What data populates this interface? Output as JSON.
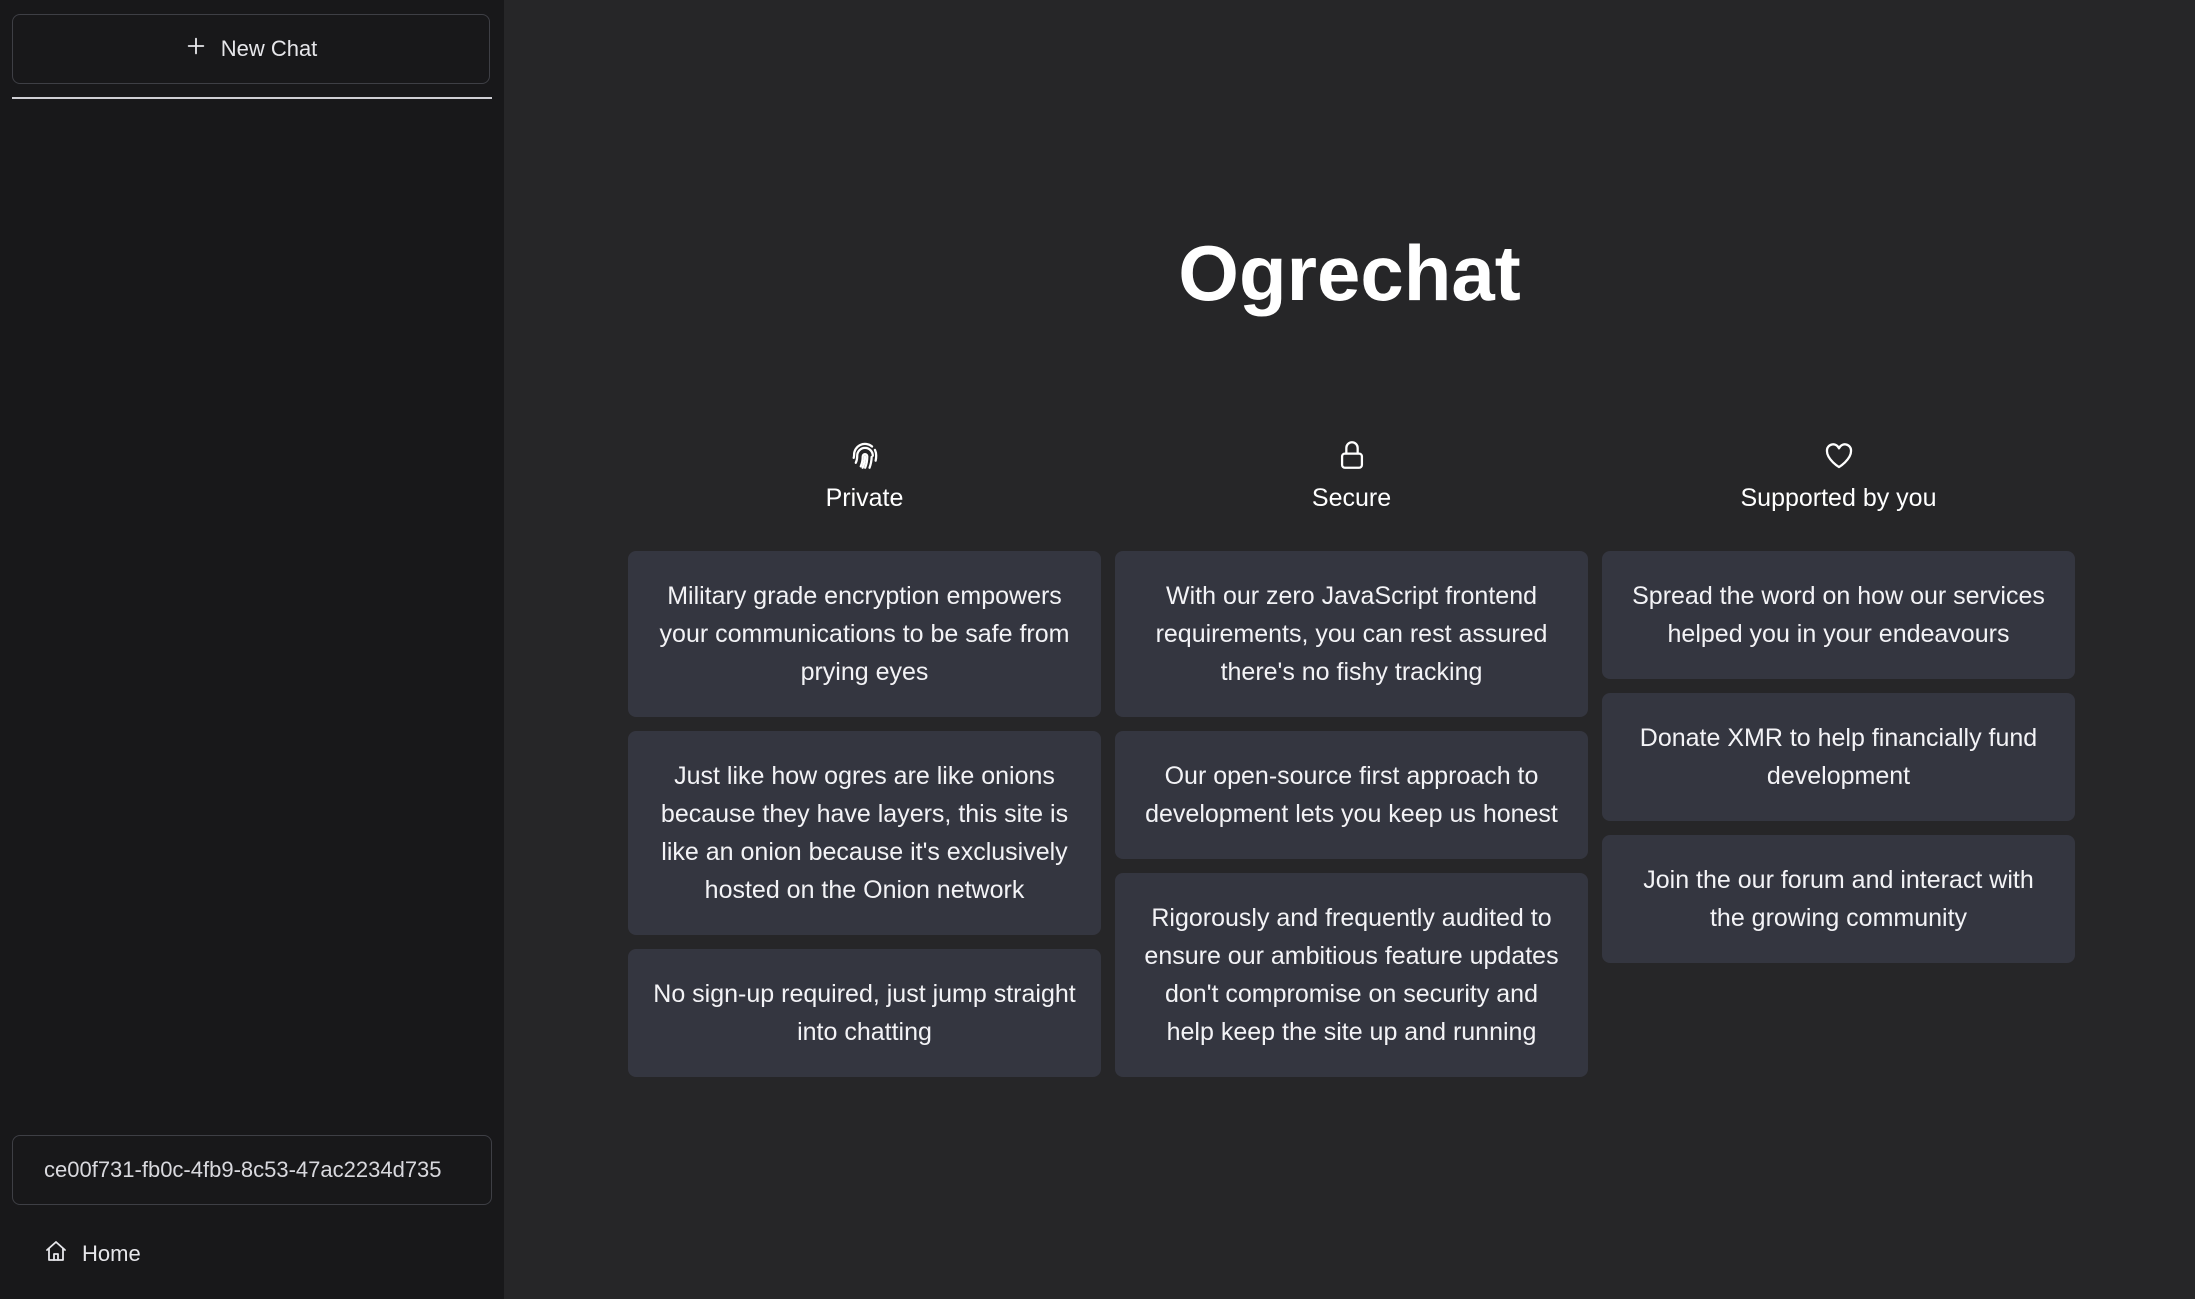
{
  "sidebar": {
    "new_chat_label": "New Chat",
    "session_id": "ce00f731-fb0c-4fb9-8c53-47ac2234d735",
    "home_label": "Home"
  },
  "main": {
    "title": "Ogrechat",
    "columns": [
      {
        "icon": "fingerprint-icon",
        "title": "Private",
        "cards": [
          "Military grade encryption empowers your communications to be safe from prying eyes",
          "Just like how ogres are like onions because they have layers, this site is like an onion because it's exclusively hosted on the Onion network",
          "No sign-up required, just jump straight into chatting"
        ]
      },
      {
        "icon": "lock-icon",
        "title": "Secure",
        "cards": [
          "With our zero JavaScript frontend requirements, you can rest assured there's no fishy tracking",
          "Our open-source first approach to development lets you keep us honest",
          "Rigorously and frequently audited to ensure our ambitious feature updates don't compromise on security and help keep the site up and running"
        ]
      },
      {
        "icon": "heart-icon",
        "title": "Supported by you",
        "cards": [
          "Spread the word on how our services helped you in your endeavours",
          "Donate XMR to help financially fund development",
          "Join the our forum and interact with the growing community"
        ]
      }
    ]
  }
}
